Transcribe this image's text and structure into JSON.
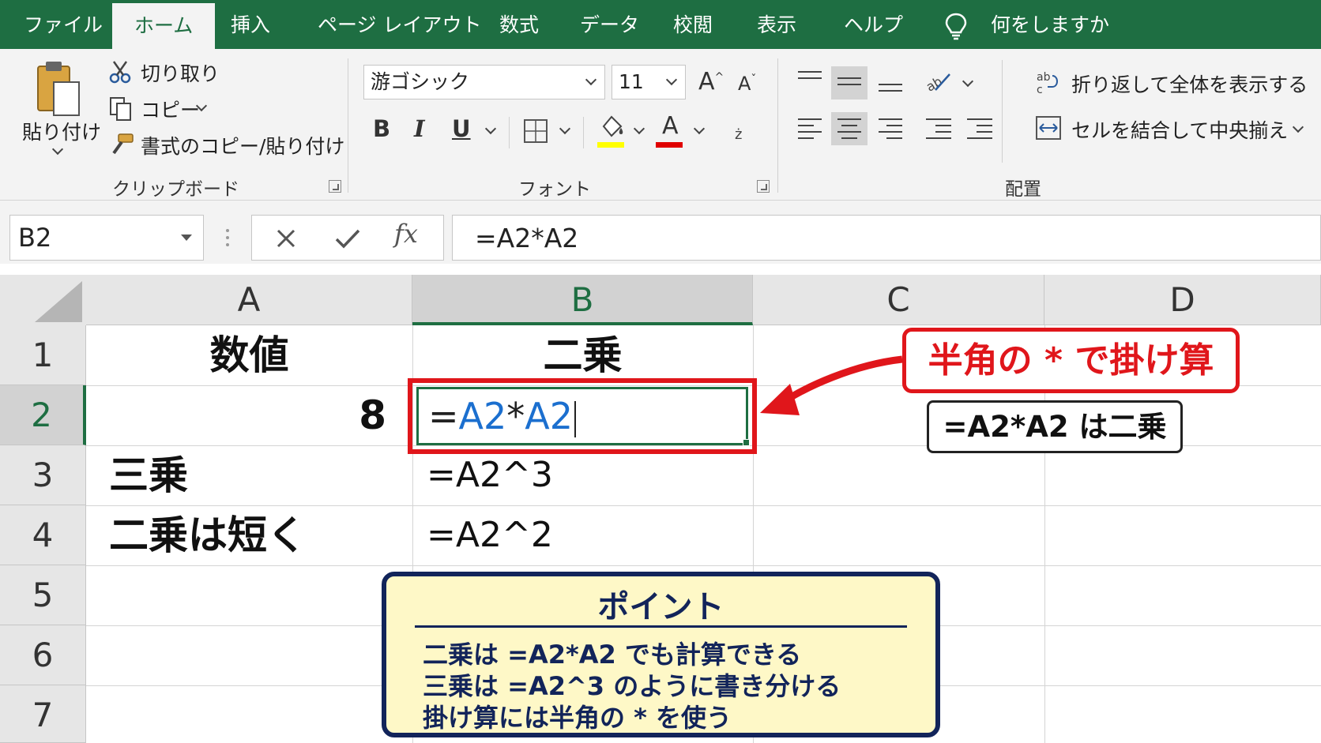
{
  "menu": {
    "tabs": [
      "ファイル",
      "ホーム",
      "挿入",
      "ページ レイアウト",
      "数式",
      "データ",
      "校閲",
      "表示",
      "ヘルプ"
    ],
    "active_tab": "ホーム",
    "tell_me": "何をしますか"
  },
  "ribbon": {
    "clipboard": {
      "paste": "貼り付け",
      "cut": "切り取り",
      "copy": "コピー",
      "format_painter": "書式のコピー/貼り付け",
      "group_label": "クリップボード"
    },
    "font": {
      "font_name": "游ゴシック",
      "font_size": "11",
      "bold": "B",
      "italic": "I",
      "underline": "U",
      "group_label": "フォント",
      "highlight_color": "#ffff00",
      "font_color": "#e00000"
    },
    "alignment": {
      "wrap_text": "折り返して全体を表示する",
      "merge_center": "セルを結合して中央揃え",
      "group_label": "配置"
    }
  },
  "formula_bar": {
    "name_box": "B2",
    "formula": "=A2*A2"
  },
  "sheet": {
    "columns": [
      "A",
      "B",
      "C",
      "D"
    ],
    "selected_column": "B",
    "rows": [
      "1",
      "2",
      "3",
      "4",
      "5",
      "6",
      "7"
    ],
    "selected_row": "2",
    "cells": {
      "A1": "数値",
      "B1": "二乗",
      "A2": "8",
      "B2_prefix": "=",
      "B2_ref1": "A2",
      "B2_op": "*",
      "B2_ref2": "A2",
      "A3": "三乗",
      "B3": "=A2^3",
      "A4": "二乗は短く",
      "B4": "=A2^2"
    }
  },
  "annotations": {
    "callout": "半角の * で掛け算",
    "note": "=A2*A2 は二乗",
    "point": {
      "title": "ポイント",
      "lines": [
        "二乗は =A2*A2 でも計算できる",
        "三乗は =A2^3 のように書き分ける",
        "掛け算には半角の * を使う"
      ]
    }
  },
  "colors": {
    "excel_green": "#1e6e42",
    "annotation_red": "#e0161b",
    "reference_blue": "#1b6fcf",
    "point_navy": "#12245a",
    "point_background": "#fef8c7"
  }
}
